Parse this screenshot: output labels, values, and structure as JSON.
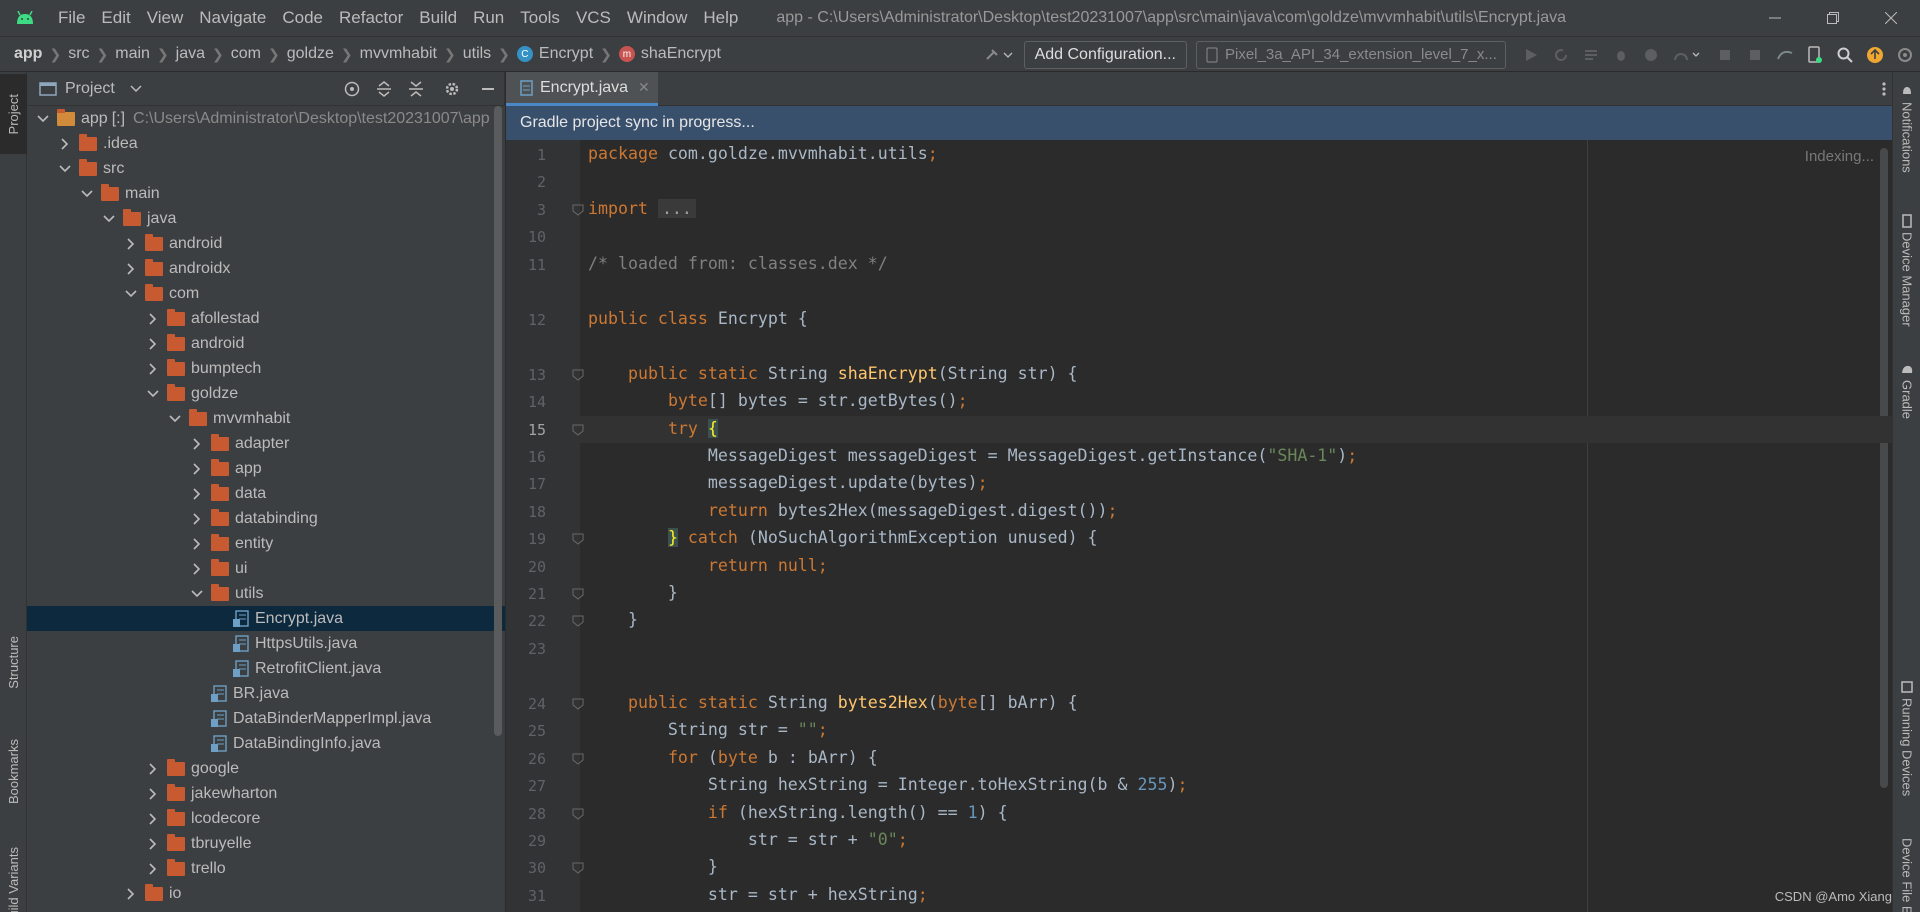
{
  "window": {
    "title": "app - C:\\Users\\Administrator\\Desktop\\test20231007\\app\\src\\main\\java\\com\\goldze\\mvvmhabit\\utils\\Encrypt.java"
  },
  "menu": [
    "File",
    "Edit",
    "View",
    "Navigate",
    "Code",
    "Refactor",
    "Build",
    "Run",
    "Tools",
    "VCS",
    "Window",
    "Help"
  ],
  "breadcrumb": {
    "items": [
      "app",
      "src",
      "main",
      "java",
      "com",
      "goldze",
      "mvvmhabit",
      "utils",
      "Encrypt",
      "shaEncrypt"
    ],
    "class_badge": "C",
    "method_badge": "m"
  },
  "toolbar": {
    "add_configuration": "Add Configuration...",
    "device": "Pixel_3a_API_34_extension_level_7_x..."
  },
  "left_strip": {
    "project": "Project",
    "structure": "Structure",
    "bookmarks": "Bookmarks",
    "build_variants": "Build Variants"
  },
  "right_strip": {
    "notifications": "Notifications",
    "device_manager": "Device Manager",
    "gradle": "Gradle",
    "running_devices": "Running Devices",
    "device_file_explorer": "Device File Explorer"
  },
  "project_panel": {
    "title": "Project",
    "tree": [
      {
        "label": "app",
        "suffix": "[:]",
        "path": "C:\\Users\\Administrator\\Desktop\\test20231007\\app",
        "kind": "module",
        "depth": 0,
        "expanded": true
      },
      {
        "label": ".idea",
        "kind": "folder",
        "depth": 1,
        "expanded": false
      },
      {
        "label": "src",
        "kind": "folder",
        "depth": 1,
        "expanded": true
      },
      {
        "label": "main",
        "kind": "folder",
        "depth": 2,
        "expanded": true
      },
      {
        "label": "java",
        "kind": "folder",
        "depth": 3,
        "expanded": true
      },
      {
        "label": "android",
        "kind": "folder",
        "depth": 4,
        "expanded": false
      },
      {
        "label": "androidx",
        "kind": "folder",
        "depth": 4,
        "expanded": false
      },
      {
        "label": "com",
        "kind": "folder",
        "depth": 4,
        "expanded": true
      },
      {
        "label": "afollestad",
        "kind": "folder",
        "depth": 5,
        "expanded": false
      },
      {
        "label": "android",
        "kind": "folder",
        "depth": 5,
        "expanded": false
      },
      {
        "label": "bumptech",
        "kind": "folder",
        "depth": 5,
        "expanded": false
      },
      {
        "label": "goldze",
        "kind": "folder",
        "depth": 5,
        "expanded": true
      },
      {
        "label": "mvvmhabit",
        "kind": "folder",
        "depth": 6,
        "expanded": true
      },
      {
        "label": "adapter",
        "kind": "folder",
        "depth": 7,
        "expanded": false
      },
      {
        "label": "app",
        "kind": "folder",
        "depth": 7,
        "expanded": false
      },
      {
        "label": "data",
        "kind": "folder",
        "depth": 7,
        "expanded": false
      },
      {
        "label": "databinding",
        "kind": "folder",
        "depth": 7,
        "expanded": false
      },
      {
        "label": "entity",
        "kind": "folder",
        "depth": 7,
        "expanded": false
      },
      {
        "label": "ui",
        "kind": "folder",
        "depth": 7,
        "expanded": false
      },
      {
        "label": "utils",
        "kind": "folder",
        "depth": 7,
        "expanded": true
      },
      {
        "label": "Encrypt.java",
        "kind": "java",
        "depth": 8,
        "selected": true
      },
      {
        "label": "HttpsUtils.java",
        "kind": "java",
        "depth": 8
      },
      {
        "label": "RetrofitClient.java",
        "kind": "java",
        "depth": 8
      },
      {
        "label": "BR.java",
        "kind": "java",
        "depth": 7
      },
      {
        "label": "DataBinderMapperImpl.java",
        "kind": "java",
        "depth": 7
      },
      {
        "label": "DataBindingInfo.java",
        "kind": "java",
        "depth": 7
      },
      {
        "label": "google",
        "kind": "folder",
        "depth": 5,
        "expanded": false
      },
      {
        "label": "jakewharton",
        "kind": "folder",
        "depth": 5,
        "expanded": false
      },
      {
        "label": "lcodecore",
        "kind": "folder",
        "depth": 5,
        "expanded": false
      },
      {
        "label": "tbruyelle",
        "kind": "folder",
        "depth": 5,
        "expanded": false
      },
      {
        "label": "trello",
        "kind": "folder",
        "depth": 5,
        "expanded": false
      },
      {
        "label": "io",
        "kind": "folder",
        "depth": 4,
        "expanded": false
      }
    ]
  },
  "editor": {
    "tab": "Encrypt.java",
    "banner": "Gradle project sync in progress...",
    "indexing": "Indexing...",
    "current_line": "15",
    "lines": [
      {
        "n": "1",
        "code": [
          [
            "kw",
            "package "
          ],
          [
            "",
            "com.goldze.mvvmhabit.utils"
          ],
          [
            "kw",
            ";"
          ]
        ]
      },
      {
        "n": "2",
        "code": []
      },
      {
        "n": "3",
        "code": [
          [
            "kw",
            "import "
          ],
          [
            "folded",
            "..."
          ]
        ],
        "fold": true
      },
      {
        "n": "10",
        "code": []
      },
      {
        "n": "11",
        "code": [
          [
            "cmt",
            "/* loaded from: classes.dex */"
          ]
        ]
      },
      {
        "n": "12",
        "code": [
          [
            "kw",
            "public class "
          ],
          [
            "",
            "Encrypt {"
          ]
        ]
      },
      {
        "n": "13",
        "code": [
          [
            "",
            "    "
          ],
          [
            "kw",
            "public static "
          ],
          [
            "",
            "String "
          ],
          [
            "fn",
            "shaEncrypt"
          ],
          [
            "",
            "(String str) {"
          ]
        ],
        "fold": true
      },
      {
        "n": "14",
        "code": [
          [
            "",
            "        "
          ],
          [
            "kw",
            "byte"
          ],
          [
            "",
            "[] bytes = str.getBytes()"
          ],
          [
            "kw",
            ";"
          ]
        ]
      },
      {
        "n": "15",
        "code": [
          [
            "",
            "        "
          ],
          [
            "kw",
            "try "
          ],
          [
            "hl",
            "{"
          ]
        ],
        "fold": true
      },
      {
        "n": "16",
        "code": [
          [
            "",
            "            MessageDigest messageDigest = MessageDigest."
          ],
          [
            "",
            "getInstance("
          ],
          [
            "str",
            "\"SHA-1\""
          ],
          [
            "",
            ")"
          ],
          [
            "kw",
            ";"
          ]
        ]
      },
      {
        "n": "17",
        "code": [
          [
            "",
            "            messageDigest.update(bytes)"
          ],
          [
            "kw",
            ";"
          ]
        ]
      },
      {
        "n": "18",
        "code": [
          [
            "",
            "            "
          ],
          [
            "kw",
            "return "
          ],
          [
            "",
            "bytes2Hex(messageDigest.digest())"
          ],
          [
            "kw",
            ";"
          ]
        ]
      },
      {
        "n": "19",
        "code": [
          [
            "",
            "        "
          ],
          [
            "hl",
            "}"
          ],
          [
            "kw",
            " catch "
          ],
          [
            "",
            "(NoSuchAlgorithmException unused) {"
          ]
        ],
        "fold": true
      },
      {
        "n": "20",
        "code": [
          [
            "",
            "            "
          ],
          [
            "kw",
            "return null"
          ],
          [
            "kw",
            ";"
          ]
        ]
      },
      {
        "n": "21",
        "code": [
          [
            "",
            "        }"
          ]
        ],
        "fold": true
      },
      {
        "n": "22",
        "code": [
          [
            "",
            "    }"
          ]
        ],
        "fold": true
      },
      {
        "n": "23",
        "code": []
      },
      {
        "n": "24",
        "code": [
          [
            "",
            "    "
          ],
          [
            "kw",
            "public static "
          ],
          [
            "",
            "String "
          ],
          [
            "fn",
            "bytes2Hex"
          ],
          [
            "",
            "("
          ],
          [
            "kw",
            "byte"
          ],
          [
            "",
            "[] bArr) {"
          ]
        ],
        "fold": true
      },
      {
        "n": "25",
        "code": [
          [
            "",
            "        String str = "
          ],
          [
            "str",
            "\"\""
          ],
          [
            "kw",
            ";"
          ]
        ]
      },
      {
        "n": "26",
        "code": [
          [
            "",
            "        "
          ],
          [
            "kw",
            "for "
          ],
          [
            "",
            "("
          ],
          [
            "kw",
            "byte "
          ],
          [
            "",
            "b : bArr) {"
          ]
        ],
        "fold": true
      },
      {
        "n": "27",
        "code": [
          [
            "",
            "            String hexString = Integer."
          ],
          [
            "",
            "toHexString(b & "
          ],
          [
            "num",
            "255"
          ],
          [
            "",
            ")"
          ],
          [
            "kw",
            ";"
          ]
        ]
      },
      {
        "n": "28",
        "code": [
          [
            "",
            "            "
          ],
          [
            "kw",
            "if "
          ],
          [
            "",
            "(hexString.length() == "
          ],
          [
            "num",
            "1"
          ],
          [
            "",
            ") {"
          ]
        ],
        "fold": true
      },
      {
        "n": "29",
        "code": [
          [
            "",
            "                str = str + "
          ],
          [
            "str",
            "\"0\""
          ],
          [
            "kw",
            ";"
          ]
        ]
      },
      {
        "n": "30",
        "code": [
          [
            "",
            "            }"
          ]
        ],
        "fold": true
      },
      {
        "n": "31",
        "code": [
          [
            "",
            "            str = str + hexString"
          ],
          [
            "kw",
            ";"
          ]
        ]
      }
    ]
  },
  "watermark": "CSDN @Amo Xiang"
}
